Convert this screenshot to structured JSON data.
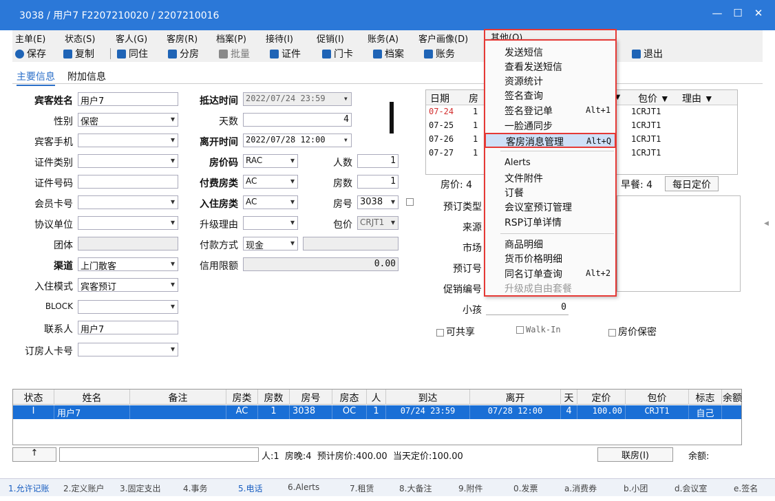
{
  "window": {
    "title": "3038 / 用户7 F2207210020 / 2207210016",
    "controls": [
      "—",
      "☐",
      "✕"
    ]
  },
  "menubar": [
    "主单(E)",
    "状态(S)",
    "客人(G)",
    "客房(R)",
    "档案(P)",
    "接待(I)",
    "促销(I)",
    "账务(A)",
    "客户画像(D)",
    "其他(O)"
  ],
  "toolbar": {
    "save": "保存",
    "copy": "复制",
    "cohabit": "同住",
    "split": "分房",
    "batch": "批量",
    "cert": "证件",
    "card": "门卡",
    "archive": "档案",
    "account": "账务",
    "exit": "退出"
  },
  "tabs": {
    "main": "主要信息",
    "extra": "附加信息"
  },
  "form": {
    "guest_name_label": "宾客姓名",
    "guest_name": "用户7",
    "gender_label": "性别",
    "gender": "保密",
    "mobile_label": "宾客手机",
    "cert_type_label": "证件类别",
    "cert_no_label": "证件号码",
    "member_label": "会员卡号",
    "agreement_label": "协议单位",
    "group_label": "团体",
    "channel_label": "渠道",
    "channel": "上门散客",
    "checkin_mode_label": "入住模式",
    "checkin_mode": "宾客预订",
    "block_label": "BLOCK",
    "contact_label": "联系人",
    "contact": "用户7",
    "booker_label": "订房人卡号",
    "arrival_label": "抵达时间",
    "arrival": "2022/07/24 23:59",
    "days_label": "天数",
    "days": "4",
    "depart_label": "离开时间",
    "depart": "2022/07/28 12:00",
    "rate_code_label": "房价码",
    "rate_code": "RAC",
    "people_label": "人数",
    "people": "1",
    "pay_roomtype_label": "付费房类",
    "pay_roomtype": "AC",
    "rooms_label": "房数",
    "rooms": "1",
    "stay_roomtype_label": "入住房类",
    "stay_roomtype": "AC",
    "room_no_label": "房号",
    "room_no": "3038",
    "upgrade_label": "升级理由",
    "package_label": "包价",
    "package": "CRJT1",
    "pay_method_label": "付款方式",
    "pay_method": "现金",
    "credit_label": "信用限额",
    "credit": "0.00",
    "resv_type_label": "预订类型",
    "source_label": "来源",
    "market_label": "市场",
    "resv_no_label": "预订号",
    "promo_label": "促销编号",
    "child_label": "小孩",
    "child": "0",
    "share_label": "可共享",
    "walkin_label": "Walk-In",
    "rate_secret_label": "房价保密",
    "room_rate_label": "房价: 4",
    "breakfast_label": "早餐: 4",
    "daily_rate_btn": "每日定价"
  },
  "daygrid": {
    "headers": [
      "日期",
      "房",
      "▼",
      "包价 ▼",
      "理由 ▼"
    ],
    "rows": [
      {
        "date": "07-24",
        "r": "1",
        "pkg": "1CRJT1",
        "red": true
      },
      {
        "date": "07-25",
        "r": "1",
        "pkg": "1CRJT1",
        "red": false
      },
      {
        "date": "07-26",
        "r": "1",
        "pkg": "1CRJT1",
        "red": false
      },
      {
        "date": "07-27",
        "r": "1",
        "pkg": "1CRJT1",
        "red": false
      }
    ]
  },
  "table": {
    "headers": [
      "状态",
      "姓名",
      "备注",
      "房类",
      "房数",
      "房号",
      "房态",
      "人",
      "到达",
      "离开",
      "天",
      "定价",
      "包价",
      "标志",
      "余额"
    ],
    "row": [
      "I",
      "用户7",
      "",
      "AC",
      "1",
      "3038",
      "OC",
      "1",
      "07/24 23:59",
      "07/28 12:00",
      "4",
      "100.00",
      "CRJT1",
      "自己",
      ""
    ]
  },
  "bottom": {
    "arrow": "↑",
    "summary": "人:1  房晚:4  预计房价:400.00  当天定价:100.00",
    "link_btn": "联房(I)",
    "balance": "余额:"
  },
  "statusbar": [
    "1.允许记账",
    "2.定义账户",
    "3.固定支出",
    "4.事务",
    "5.电话",
    "6.Alerts",
    "7.租赁",
    "8.大备注",
    "9.附件",
    "0.发票",
    "a.消费券",
    "b.小团",
    "d.会议室",
    "e.签名"
  ],
  "other_menu": {
    "title": "其他(O)",
    "items": [
      {
        "label": "发送短信"
      },
      {
        "label": "查看发送短信"
      },
      {
        "label": "资源统计"
      },
      {
        "label": "签名查询"
      },
      {
        "label": "签名登记单",
        "shortcut": "Alt+1"
      },
      {
        "label": "一脸通同步"
      },
      {
        "label": "客房消息管理",
        "shortcut": "Alt+Q",
        "selected": true
      },
      {
        "label": "Alerts"
      },
      {
        "label": "文件附件"
      },
      {
        "label": "订餐"
      },
      {
        "label": "会议室预订管理"
      },
      {
        "label": "RSP订单详情"
      },
      {
        "label": "商品明细"
      },
      {
        "label": "货币价格明细"
      },
      {
        "label": "同名订单查询",
        "shortcut": "Alt+2"
      },
      {
        "label": "升级成自由套餐",
        "disabled": true
      }
    ]
  },
  "colors": {
    "titlebar": "#2b78d8",
    "accent": "#1a6fd6",
    "highlight_border": "#e53935",
    "red_date": "#d32f2f"
  }
}
